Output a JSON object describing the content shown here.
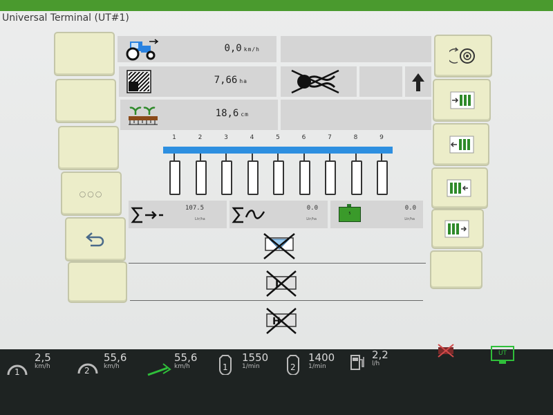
{
  "window": {
    "title": "Universal Terminal (UT#1)"
  },
  "left_softkeys": {
    "more_label": "○○○"
  },
  "readouts": {
    "speed": {
      "value": "0,0",
      "unit": "km/h"
    },
    "area": {
      "value": "7,66",
      "unit": "ha"
    },
    "depth": {
      "value": "18,6",
      "unit": "cm"
    }
  },
  "section_numbers": [
    "1",
    "2",
    "3",
    "4",
    "5",
    "6",
    "7",
    "8",
    "9"
  ],
  "totals": {
    "applied": {
      "value": "107.5",
      "unit": "Ltr/ha"
    },
    "rate": {
      "value": "0.0",
      "unit": "Ltr/ha"
    },
    "tank": {
      "value": "0.0",
      "unit": "Ltr/ha",
      "badge": "5"
    }
  },
  "status_bar": {
    "wheel_speed_1": {
      "value": "2,5",
      "unit": "km/h"
    },
    "wheel_speed_2": {
      "value": "55,6",
      "unit": "km/h"
    },
    "ground_speed": {
      "value": "55,6",
      "unit": "km/h"
    },
    "engine_1": {
      "badge": "1",
      "value": "1550",
      "unit": "1/min"
    },
    "engine_2": {
      "badge": "2",
      "value": "1400",
      "unit": "1/min"
    },
    "fuel": {
      "value": "2,2",
      "unit": "l/h"
    },
    "ut_label": "UT"
  },
  "colors": {
    "accent": "#4a9a2e",
    "softkey": "#ecedc9",
    "boom": "#2d8fe0",
    "cell": "#d5d5d5"
  }
}
